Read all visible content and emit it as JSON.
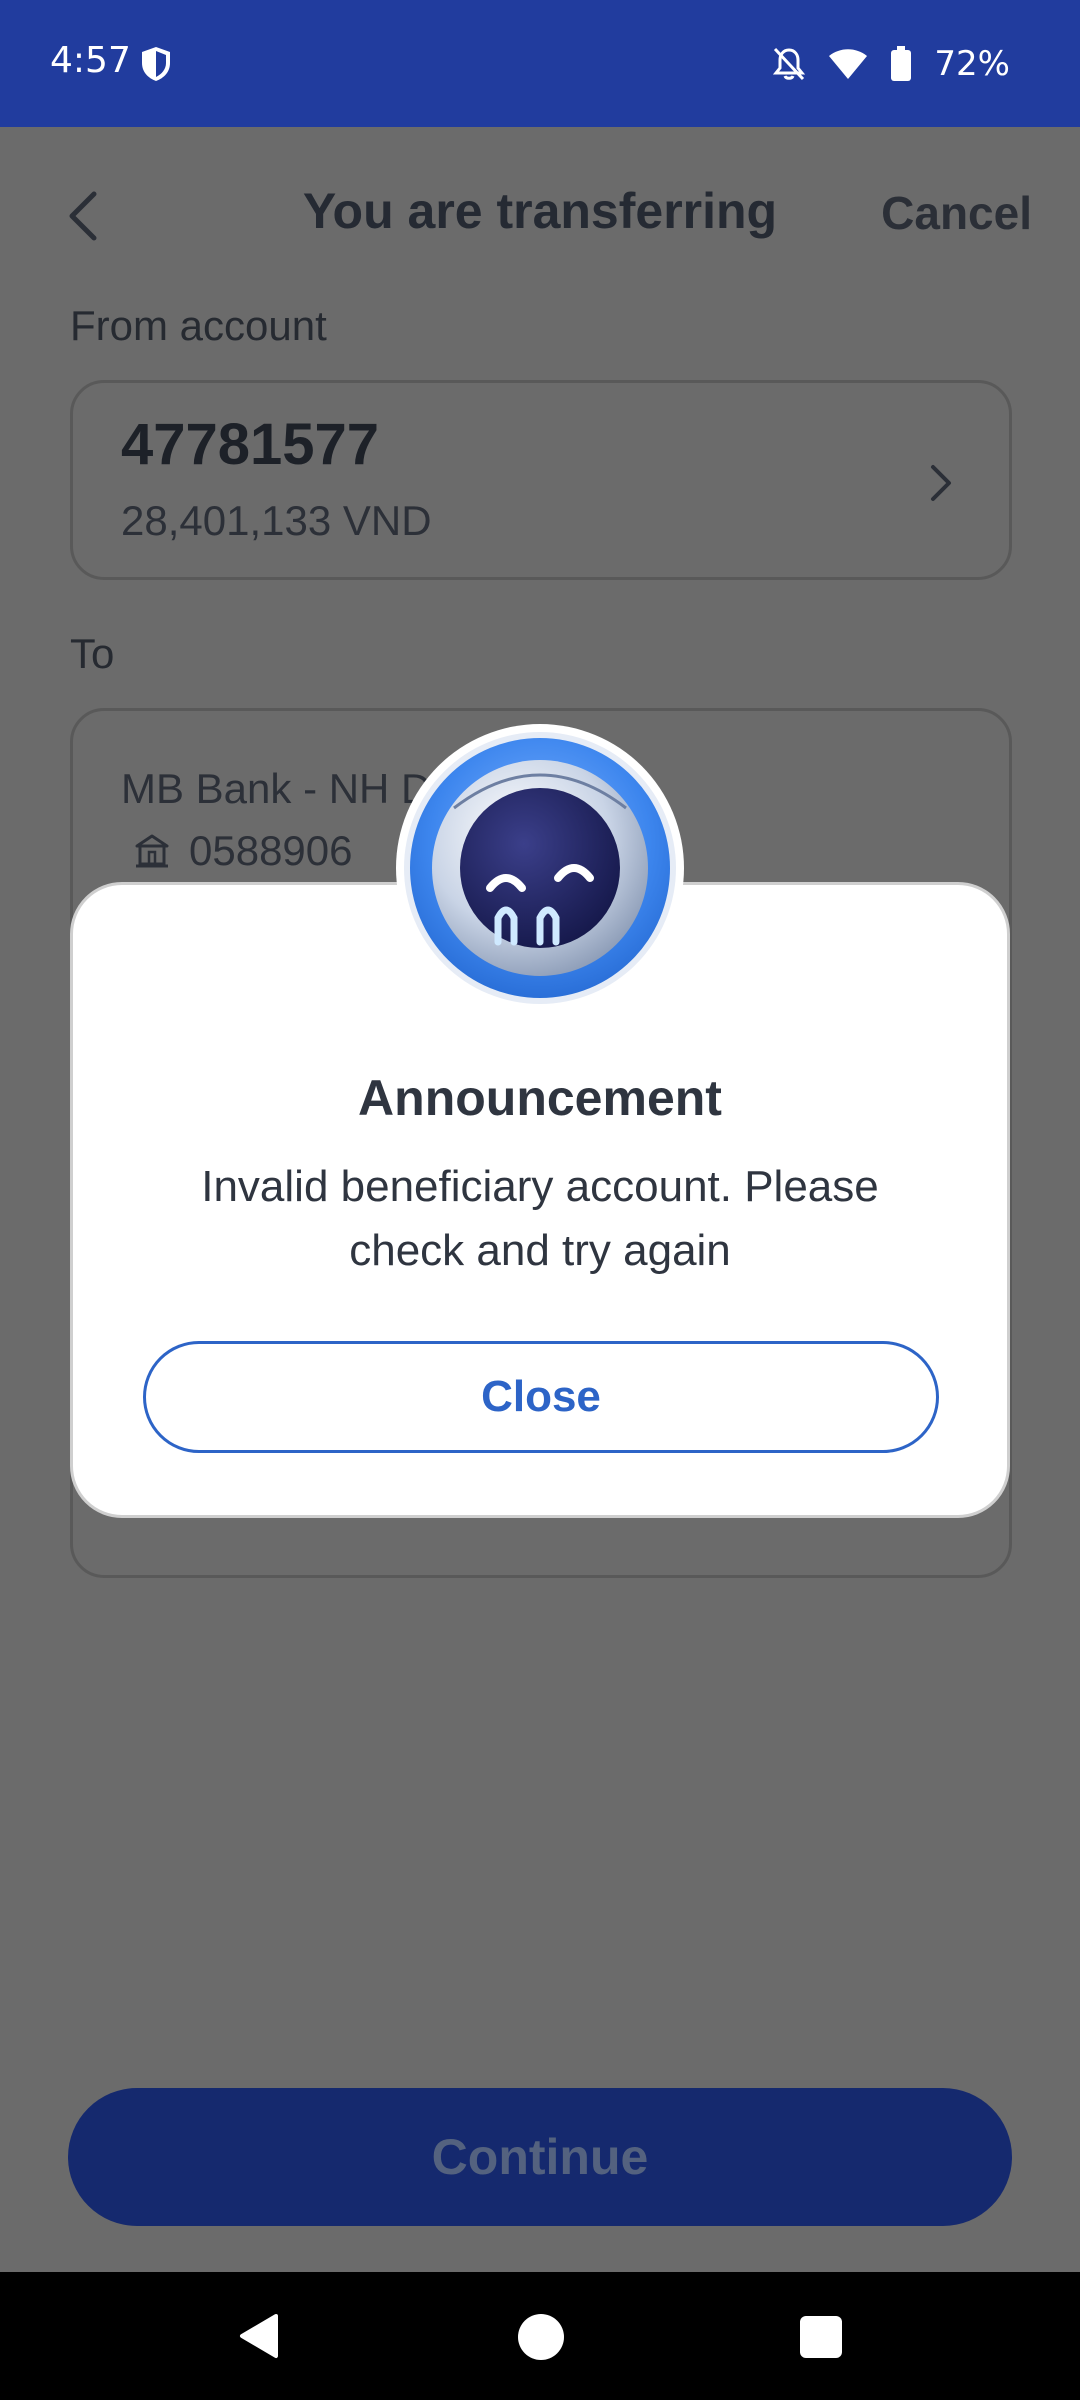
{
  "status_bar": {
    "time": "4:57",
    "battery_text": "72%",
    "icons": [
      "shield-icon",
      "bell-off-icon",
      "wifi-icon",
      "battery-icon"
    ]
  },
  "header": {
    "title": "You are transferring",
    "cancel_label": "Cancel"
  },
  "from": {
    "label": "From account",
    "account_number": "47781577",
    "balance": "28,401,133 VND"
  },
  "to": {
    "label": "To",
    "bank_name": "MB Bank - NH Doi",
    "account_number": "0588906"
  },
  "continue_label": "Continue",
  "dialog": {
    "title": "Announcement",
    "message": "Invalid beneficiary account. Please check and try again",
    "close_label": "Close"
  },
  "colors": {
    "status_bar": "#213c9e",
    "overlay": "#6b6b6b",
    "accent": "#2d64c7",
    "continue_button": "#15296e"
  }
}
